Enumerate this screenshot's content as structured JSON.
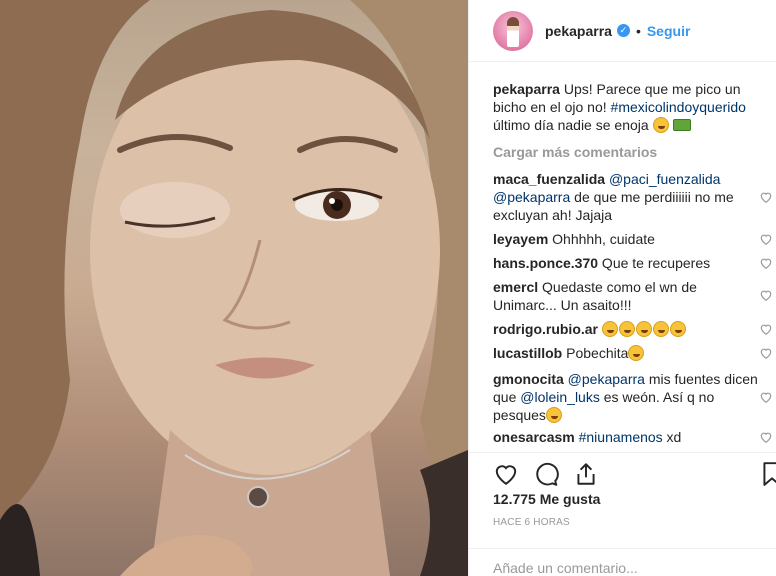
{
  "photo": {
    "alt": ""
  },
  "header": {
    "username": "pekaparra",
    "follow_label": "Seguir",
    "separator": "•"
  },
  "caption": {
    "username": "pekaparra",
    "text_1": " Ups! Parece que me pico un bicho en el ojo no! ",
    "hashtag": "#mexicolindoyquerido",
    "text_2": " último día nadie se enoja "
  },
  "load_more_label": "Cargar más comentarios",
  "comments": [
    {
      "user": "maca_fuenzalida",
      "mention_1": "@paci_fuenzalida",
      "mention_2": "@pekaparra",
      "text": " de que me perdiiiiii no me excluyan ah! Jajaja"
    },
    {
      "user": "leyayem",
      "text": " Ohhhhh, cuidate"
    },
    {
      "user": "hans.ponce.370",
      "text": " Que te recuperes"
    },
    {
      "user": "emercl",
      "text": " Quedaste como el wn de Unimarc... Un asaito!!!"
    },
    {
      "user": "rodrigo.rubio.ar",
      "text": " "
    },
    {
      "user": "lucastillob",
      "text": " Pobechita"
    },
    {
      "user": "gmonocita",
      "mention_1": "@pekaparra",
      "text_1": " mis fuentes dicen que ",
      "mention_2": "@lolein_luks",
      "text_2": " es weón. Así q no pesques"
    },
    {
      "user": "onesarcasm",
      "hashtag": "#niunamenos",
      "text": " xd"
    }
  ],
  "likes_label": "12.775 Me gusta",
  "time_label": "HACE 6 HORAS",
  "add_comment": {
    "placeholder": "Añade un comentario..."
  },
  "icons": [
    "heart-icon",
    "comment-icon",
    "share-icon",
    "bookmark-icon",
    "verified-badge-icon"
  ],
  "colors": {
    "link": "#003569",
    "accent": "#3897f0",
    "muted": "#999999",
    "text": "#262626"
  }
}
